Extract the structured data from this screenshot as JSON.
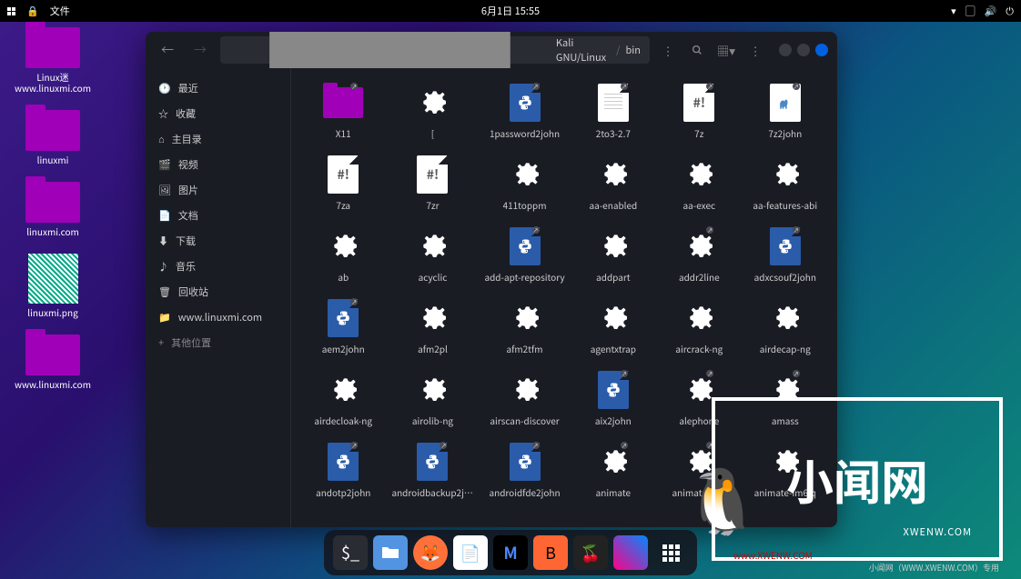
{
  "panel": {
    "files_menu": "文件",
    "datetime": "6月1日 15:55"
  },
  "desktop": [
    {
      "type": "folder",
      "label": "Linux迷 www.linuxmi.com"
    },
    {
      "type": "folder",
      "label": "linuxmi"
    },
    {
      "type": "folder",
      "label": "linuxmi.com"
    },
    {
      "type": "qr",
      "label": "linuxmi.png"
    },
    {
      "type": "folder",
      "label": "www.linuxmi.com"
    }
  ],
  "fm": {
    "path": {
      "root": "Kali GNU/Linux",
      "current": "bin"
    },
    "sidebar": [
      {
        "icon": "clock",
        "label": "最近"
      },
      {
        "icon": "star",
        "label": "收藏"
      },
      {
        "icon": "home",
        "label": "主目录"
      },
      {
        "icon": "video",
        "label": "视频"
      },
      {
        "icon": "image",
        "label": "图片"
      },
      {
        "icon": "doc",
        "label": "文档"
      },
      {
        "icon": "download",
        "label": "下载"
      },
      {
        "icon": "music",
        "label": "音乐"
      },
      {
        "icon": "trash",
        "label": "回收站"
      },
      {
        "icon": "folder",
        "label": "www.linuxmi.com"
      },
      {
        "icon": "plus",
        "label": "其他位置"
      }
    ],
    "files": [
      {
        "name": "X11",
        "type": "folder",
        "link": true
      },
      {
        "name": "[",
        "type": "gear"
      },
      {
        "name": "1password2john",
        "type": "python",
        "link": true
      },
      {
        "name": "2to3-2.7",
        "type": "text-lines",
        "link": true
      },
      {
        "name": "7z",
        "type": "script",
        "link": true
      },
      {
        "name": "7z2john",
        "type": "perl",
        "link": true
      },
      {
        "name": "7za",
        "type": "script"
      },
      {
        "name": "7zr",
        "type": "script"
      },
      {
        "name": "411toppm",
        "type": "gear"
      },
      {
        "name": "aa-enabled",
        "type": "gear"
      },
      {
        "name": "aa-exec",
        "type": "gear"
      },
      {
        "name": "aa-features-abi",
        "type": "gear"
      },
      {
        "name": "ab",
        "type": "gear"
      },
      {
        "name": "acyclic",
        "type": "gear"
      },
      {
        "name": "add-apt-repository",
        "type": "python",
        "link": true
      },
      {
        "name": "addpart",
        "type": "gear"
      },
      {
        "name": "addr2line",
        "type": "gear",
        "link": true
      },
      {
        "name": "adxcsouf2john",
        "type": "python",
        "link": true
      },
      {
        "name": "aem2john",
        "type": "python",
        "link": true
      },
      {
        "name": "afm2pl",
        "type": "gear"
      },
      {
        "name": "afm2tfm",
        "type": "gear"
      },
      {
        "name": "agentxtrap",
        "type": "gear"
      },
      {
        "name": "aircrack-ng",
        "type": "gear"
      },
      {
        "name": "airdecap-ng",
        "type": "gear"
      },
      {
        "name": "airdecloak-ng",
        "type": "gear"
      },
      {
        "name": "airolib-ng",
        "type": "gear"
      },
      {
        "name": "airscan-discover",
        "type": "gear"
      },
      {
        "name": "aix2john",
        "type": "python",
        "link": true
      },
      {
        "name": "alephone",
        "type": "gear",
        "link": true
      },
      {
        "name": "amass",
        "type": "gear",
        "link": true
      },
      {
        "name": "andotp2john",
        "type": "python",
        "link": true
      },
      {
        "name": "androidbackup2john",
        "type": "python",
        "link": true
      },
      {
        "name": "androidfde2john",
        "type": "python",
        "link": true
      },
      {
        "name": "animate",
        "type": "gear",
        "link": true
      },
      {
        "name": "animate-im6",
        "type": "gear",
        "link": true
      },
      {
        "name": "animate-im6.q",
        "type": "gear"
      }
    ]
  },
  "watermark": {
    "main": "小闻网",
    "sub": "www.XWENW.COM",
    "tag": "XWENW.COM",
    "credit": "小闻网（WWW.XWENW.COM）专用"
  }
}
